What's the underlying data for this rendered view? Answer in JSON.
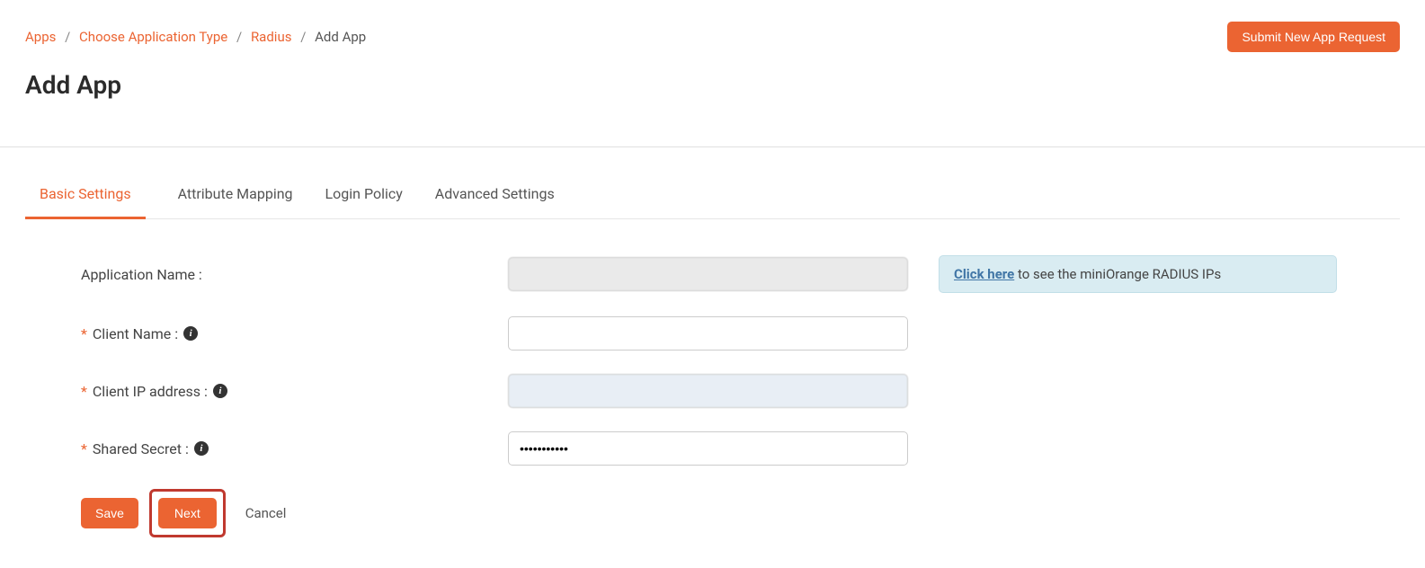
{
  "breadcrumb": {
    "level1": "Apps",
    "level2": "Choose Application Type",
    "level3": "Radius",
    "current": "Add App"
  },
  "header": {
    "submit_request": "Submit New App Request",
    "page_title": "Add App"
  },
  "tabs": {
    "basic": "Basic Settings",
    "attribute": "Attribute Mapping",
    "login": "Login Policy",
    "advanced": "Advanced Settings"
  },
  "form": {
    "app_name_label": "Application Name :",
    "app_name_value": "",
    "client_name_label": "Client Name :",
    "client_name_value": "",
    "client_ip_label": "Client IP address :",
    "client_ip_value": "",
    "shared_secret_label": "Shared Secret :",
    "shared_secret_value": "•••••••••••"
  },
  "info": {
    "link_text": "Click here",
    "rest_text": " to see the miniOrange RADIUS IPs"
  },
  "actions": {
    "save": "Save",
    "next": "Next",
    "cancel": "Cancel"
  }
}
